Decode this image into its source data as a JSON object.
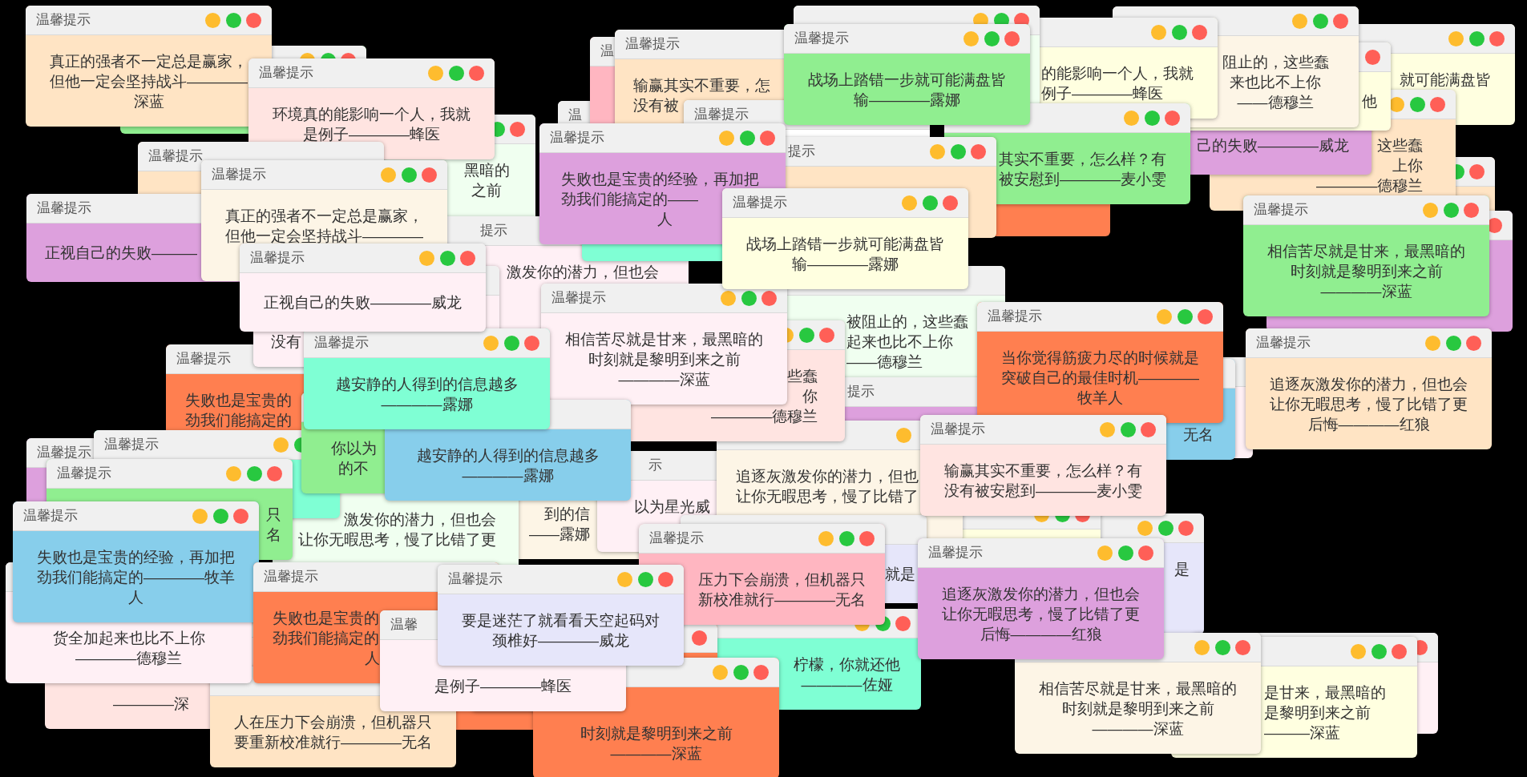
{
  "desktop": {
    "windows": [
      {
        "title": "温馨提示",
        "message": "真正的强者不一定总是赢家，但他一定会坚持战斗————深蓝",
        "color": "#ffe4c4"
      },
      {
        "title": "温馨提示",
        "message": "环境真的能影响一个人，我就是例子————蜂医",
        "color": "#ffe4e1"
      },
      {
        "title": "温",
        "color": "#ffb6c1"
      },
      {
        "title": "温馨提示",
        "lines": [
          "输赢其实不重要，怎",
          "没有被"
        ],
        "color": "#ffe4c4"
      },
      {
        "title": "温馨提示",
        "message": "战场上踏错一步就可能满盘皆输————露娜",
        "color": "#90ee90"
      },
      {
        "message": "的能影响一个人，我就例子————蜂医",
        "color": "#ffffe0"
      },
      {
        "message": "阻止的，这些蠢来也比不上你——德穆兰",
        "color": "#fdf5e6"
      },
      {
        "message": "他",
        "color": "#ffffe0"
      },
      {
        "message": "就可能满盘皆",
        "color": "#ffffe0"
      },
      {
        "title": "温"
      },
      {
        "title": "温馨提示"
      },
      {
        "title": "温馨提示",
        "color": "#ffe4c4"
      },
      {
        "title": "温馨提示",
        "message": "真正的强者不一定总是赢家，但他一定会坚持战斗————",
        "color": "#fdf5e6"
      },
      {
        "message": "黑暗的之前",
        "color": "#f0fff0"
      },
      {
        "title": "温馨提示",
        "lines": [
          "失败也是宝贵的经验，再加把",
          "劲我们能搞定的——",
          "人"
        ],
        "color": "#dda0dd"
      },
      {
        "title": "提示",
        "color": "#ffe4c4"
      },
      {
        "message": "其实不重要，怎么样？有被安慰到————麦小雯",
        "color": "#90ee90"
      },
      {
        "message": "己的失败————威龙",
        "color": "#dda0dd"
      },
      {
        "lines": [
          "这些蠢",
          "上你",
          "————德穆兰"
        ],
        "color": "#ffe4c4"
      },
      {
        "title": "温馨提示",
        "message": "正视自己的失败———",
        "color": "#dda0dd"
      },
      {
        "title": "温馨提示",
        "message": "正视自己的失败————威龙",
        "color": "#fff0f5"
      },
      {
        "title": "提示",
        "message": "激发你的潜力，但也会",
        "color": "#fff0f5"
      },
      {
        "title": "温馨提示",
        "message": "战场上踏错一步就可能满盘皆输————露娜",
        "color": "#ffffe0"
      },
      {
        "title": "温馨提示",
        "message": "相信苦尽就是甘来，最黑暗的时刻就是黎明到来之前————深蓝",
        "color": "#90ee90"
      },
      {
        "message": "没有",
        "color": "#fff0f5"
      },
      {
        "title": "温馨提示",
        "message": "失败也是宝贵的劲我们能搞定的",
        "color": "#ff7f50"
      },
      {
        "title": "温馨提示",
        "message": "越安静的人得到的信息越多————露娜",
        "color": "#7fffd4"
      },
      {
        "title": "温馨提示",
        "message": "相信苦尽就是甘来，最黑暗的时刻就是黎明到来之前————深蓝",
        "color": "#fff0f5"
      },
      {
        "lines": [
          "些蠢",
          "你",
          "————德穆兰"
        ],
        "color": "#ffe4e1"
      },
      {
        "message": "被阻止的，这些蠢起来也比不上你——德穆兰",
        "color": "#f0fff0"
      },
      {
        "title": "提示",
        "color": "#dda0dd"
      },
      {
        "title": "温馨提示",
        "message": "当你觉得筋疲力尽的时候就是突破自己的最佳时机————牧羊人",
        "color": "#ff7f50"
      },
      {
        "title": "温馨提示",
        "message": "追逐灰激发你的潜力，但也会让你无暇思考，慢了比错了更后悔————红狼",
        "color": "#ffe4c4"
      },
      {
        "title": "温馨提示",
        "color": "#dda0dd"
      },
      {
        "title": "温馨提示",
        "color": "#7fffd4"
      },
      {
        "message": "你以为的不",
        "color": "#90ee90"
      },
      {
        "message": "越安静的人得到的信息越多————露娜",
        "color": "#87ceeb"
      },
      {
        "title": "示",
        "message": "以为星光威",
        "color": "#fff0f5"
      },
      {
        "title": "温馨提示",
        "message": "输赢其实不重要，怎么样？有没有被安慰到————麦小雯",
        "color": "#ffe4e1"
      },
      {
        "message": "无名",
        "color": "#87ceeb"
      },
      {
        "title": "温馨提示",
        "message": "只名",
        "color": "#90ee90"
      },
      {
        "lines": [
          "到的信",
          "——露娜"
        ],
        "color": "#fdf5e6"
      },
      {
        "message": "追逐灰激发你的潜力，但也让你无暇思考，慢了比错了",
        "color": "#fdf5e6"
      },
      {
        "title": "温馨提示",
        "message": "失败也是宝贵的经验，再加把劲我们能搞定的————牧羊人",
        "color": "#87ceeb"
      },
      {
        "lines": [
          "激发你的潜力，但也会",
          "让你无暇思考，慢了比错了更"
        ],
        "color": "#f0fff0"
      },
      {
        "title": "温馨提示",
        "message": "压力下会崩溃，但机器只新校准就行————无名",
        "color": "#ffb6c1"
      },
      {
        "message": "就是",
        "color": "#e6e6fa"
      },
      {
        "title": "温馨提示",
        "message": "追逐灰激发你的潜力，但也会让你无暇思考，慢了比错了更后悔————红狼",
        "color": "#dda0dd"
      },
      {
        "message": "是",
        "color": "#e6e6fa"
      },
      {
        "message": "货全加起来也比不上你————德穆兰",
        "color": "#fff0f5"
      },
      {
        "title": "温馨提示",
        "message": "失败也是宝贵的劲我们能搞定的人",
        "color": "#ff7f50"
      },
      {
        "title": "温馨提示",
        "message": "要是迷茫了就看看天空起码对颈椎好————威龙",
        "color": "#e6e6fa"
      },
      {
        "title": "温馨",
        "message": "是例子————蜂医",
        "color": "#fff0f5"
      },
      {
        "message": "柠檬，你就还他————佐娅",
        "color": "#7fffd4"
      },
      {
        "message": "————深",
        "color": "#ffe4e1"
      },
      {
        "message": "人在压力下会崩溃，但机器只要重新校准就行————无名",
        "color": "#ffe4c4"
      },
      {
        "message": "时刻就是黎明到来之前————深蓝",
        "color": "#ff7f50"
      },
      {
        "message": "相信苦尽就是甘来，最黑暗的时刻就是黎明到来之前————深蓝",
        "color": "#fdf5e6"
      },
      {
        "message": "是甘来，最黑暗的是黎明到来之前———深蓝",
        "color": "#ffffe0"
      },
      {
        "color": "#ffe4c4"
      },
      {
        "color": "#dda0dd"
      },
      {
        "color": "#f0fff0"
      },
      {
        "color": "#ff7f50"
      },
      {
        "color": "#90ee90"
      },
      {
        "color": "#7fffd4"
      },
      {
        "color": "#ffffe0"
      },
      {
        "color": "#fff0f5"
      },
      {
        "color": "#ff7f50"
      },
      {
        "color": "#ff7f50"
      },
      {
        "color": "#fff0f5"
      }
    ]
  }
}
